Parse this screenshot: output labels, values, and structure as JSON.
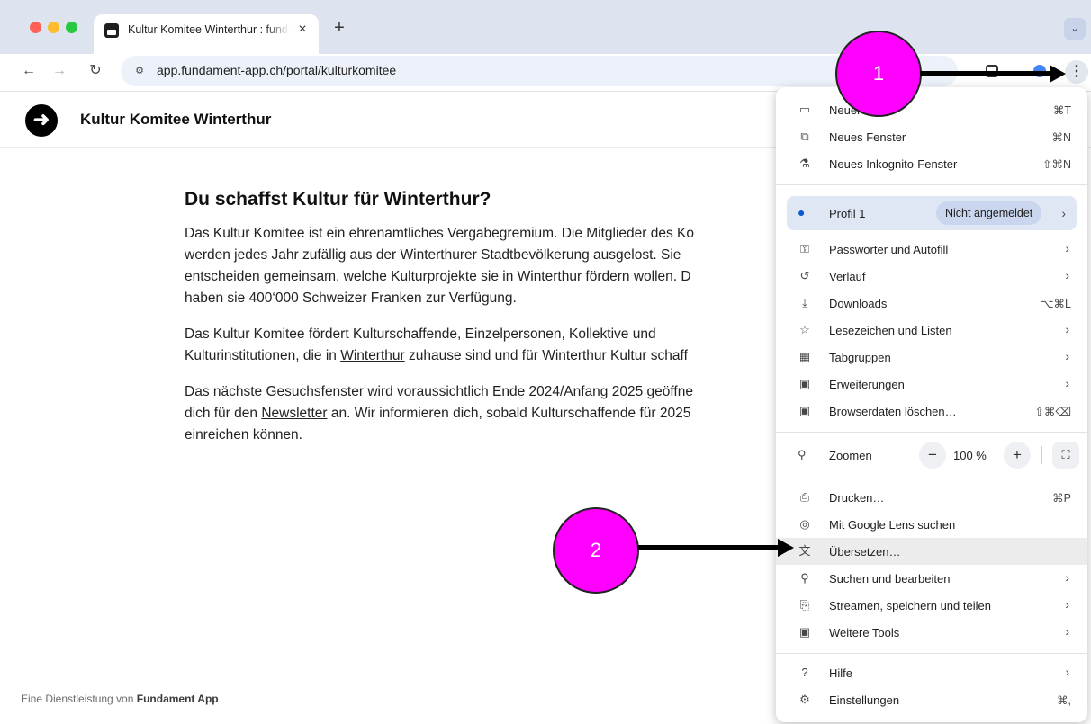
{
  "browser": {
    "tab_title": "Kultur Komitee Winterthur : fundament",
    "new_tab": "+",
    "tab_close": "×",
    "url": "app.fundament-app.ch/portal/kulturkomitee"
  },
  "page": {
    "org_title": "Kultur Komitee Winterthur",
    "headline": "Du schaffst Kultur für Winterthur?",
    "para1": [
      "Das Kultur Komitee ist ein ehrenamtliches Vergabegremium. Die Mitglieder des Ko",
      "werden jedes Jahr zufällig aus der Winterthurer Stadtbevölkerung ausgelost. Sie",
      "entscheiden gemeinsam, welche Kulturprojekte sie in Winterthur fördern wollen. D",
      "haben sie 400‘000 Schweizer Franken zur Verfügung."
    ],
    "para2_line1": "Das Kultur Komitee fördert Kulturschaffende, Einzelpersonen, Kollektive und",
    "para2_line2_pre": "Kulturinstitutionen, die in ",
    "para2_line2_link": "Winterthur",
    "para2_line2_post": " zuhause sind und für Winterthur Kultur schaff",
    "para3_line1": "Das nächste Gesuchsfenster wird voraussichtlich Ende 2024/Anfang 2025 geöffne",
    "para3_line2_pre": "dich für den ",
    "para3_line2_link": "Newsletter",
    "para3_line2_post": " an. Wir informieren dich, sobald Kulturschaffende für 2025",
    "para3_line3": "einreichen können.",
    "footer_pre": "Eine Dienstleistung von ",
    "footer_brand": "Fundament App"
  },
  "menu": {
    "new_tab": {
      "label": "Neuer Tab",
      "shortcut": "⌘T"
    },
    "new_window": {
      "label": "Neues Fenster",
      "shortcut": "⌘N"
    },
    "incognito": {
      "label": "Neues Inkognito-Fenster",
      "shortcut": "⇧⌘N"
    },
    "profile": {
      "label": "Profil 1",
      "badge": "Nicht angemeldet"
    },
    "passwords": {
      "label": "Passwörter und Autofill"
    },
    "history": {
      "label": "Verlauf"
    },
    "downloads": {
      "label": "Downloads",
      "shortcut": "⌥⌘L"
    },
    "bookmarks": {
      "label": "Lesezeichen und Listen"
    },
    "tabgroups": {
      "label": "Tabgruppen"
    },
    "extensions": {
      "label": "Erweiterungen"
    },
    "clear_data": {
      "label": "Browserdaten löschen…",
      "shortcut": "⇧⌘⌫"
    },
    "zoom": {
      "label": "Zoomen",
      "value": "100 %",
      "minus": "−",
      "plus": "+"
    },
    "print": {
      "label": "Drucken…",
      "shortcut": "⌘P"
    },
    "lens": {
      "label": "Mit Google Lens suchen"
    },
    "translate": {
      "label": "Übersetzen…"
    },
    "find": {
      "label": "Suchen und bearbeiten"
    },
    "cast": {
      "label": "Streamen, speichern und teilen"
    },
    "more_tools": {
      "label": "Weitere Tools"
    },
    "help": {
      "label": "Hilfe"
    },
    "settings": {
      "label": "Einstellungen",
      "shortcut": "⌘,"
    }
  },
  "annotations": {
    "step1": "1",
    "step2": "2",
    "color": "#ff00ff"
  }
}
